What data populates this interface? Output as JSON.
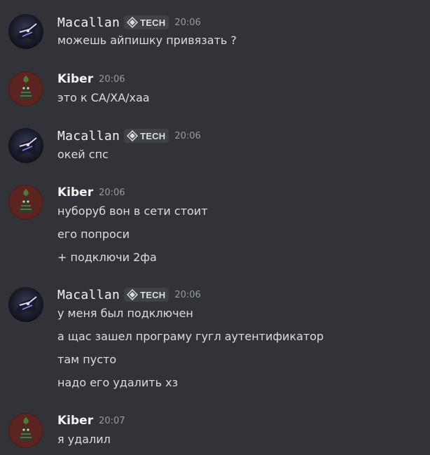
{
  "channel": {
    "messages": [
      {
        "author": "Macallan",
        "tag": "TECH",
        "time": "20:06",
        "lines": [
          "можешь айпишку привязать ?"
        ]
      },
      {
        "author": "Kiber",
        "time": "20:06",
        "lines": [
          "это к СА/ХА/хаа"
        ]
      },
      {
        "author": "Macallan",
        "tag": "TECH",
        "time": "20:06",
        "lines": [
          "окей спс"
        ]
      },
      {
        "author": "Kiber",
        "time": "20:06",
        "lines": [
          "нуборуб вон в сети стоит",
          "его попроси",
          "+ подключи 2фа"
        ]
      },
      {
        "author": "Macallan",
        "tag": "TECH",
        "time": "20:06",
        "lines": [
          "у меня был подключен",
          "а щас зашел програму гугл аутентификатор",
          "там пусто",
          "надо его удалить хз"
        ]
      },
      {
        "author": "Kiber",
        "time": "20:07",
        "lines": [
          "я удалил"
        ]
      }
    ]
  },
  "colors": {
    "background": "#313338",
    "text": "#dbdee1",
    "username": "#f2f3f5",
    "timestamp": "#949ba4",
    "tag_background": "#404249"
  },
  "icons": {
    "tag_icon": "tech-tag-icon",
    "macallan_avatar": "dark-creature-avatar",
    "kiber_avatar": "plant-creature-avatar"
  }
}
